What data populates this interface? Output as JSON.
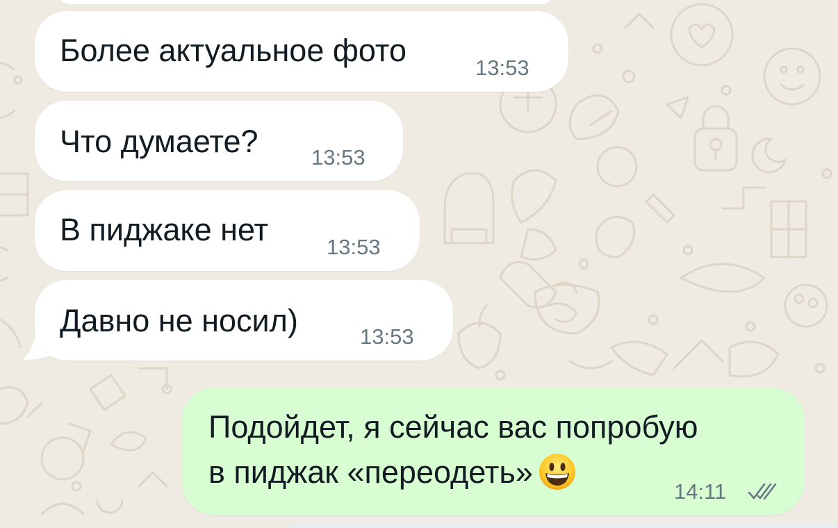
{
  "chat": {
    "messages": [
      {
        "direction": "incoming",
        "text": "Более актуальное фото",
        "time": "13:53"
      },
      {
        "direction": "incoming",
        "text": "Что думаете?",
        "time": "13:53"
      },
      {
        "direction": "incoming",
        "text": "В пиджаке нет",
        "time": "13:53"
      },
      {
        "direction": "incoming",
        "text": "Давно не носил)",
        "time": "13:53"
      },
      {
        "direction": "outgoing",
        "lines": [
          "Подойдет, я сейчас вас попробую",
          "в пиджак «переодеть»"
        ],
        "emoji": "grinning-face",
        "time": "14:11",
        "status": "read"
      }
    ]
  },
  "colors": {
    "background": "#efeae2",
    "incoming_bubble": "#ffffff",
    "outgoing_bubble": "#d9fdd3",
    "time_text": "#667781",
    "read_ticks": "#667781"
  },
  "icons": {
    "read_receipt": "double-check-icon",
    "emoji": "grinning-face-emoji"
  }
}
